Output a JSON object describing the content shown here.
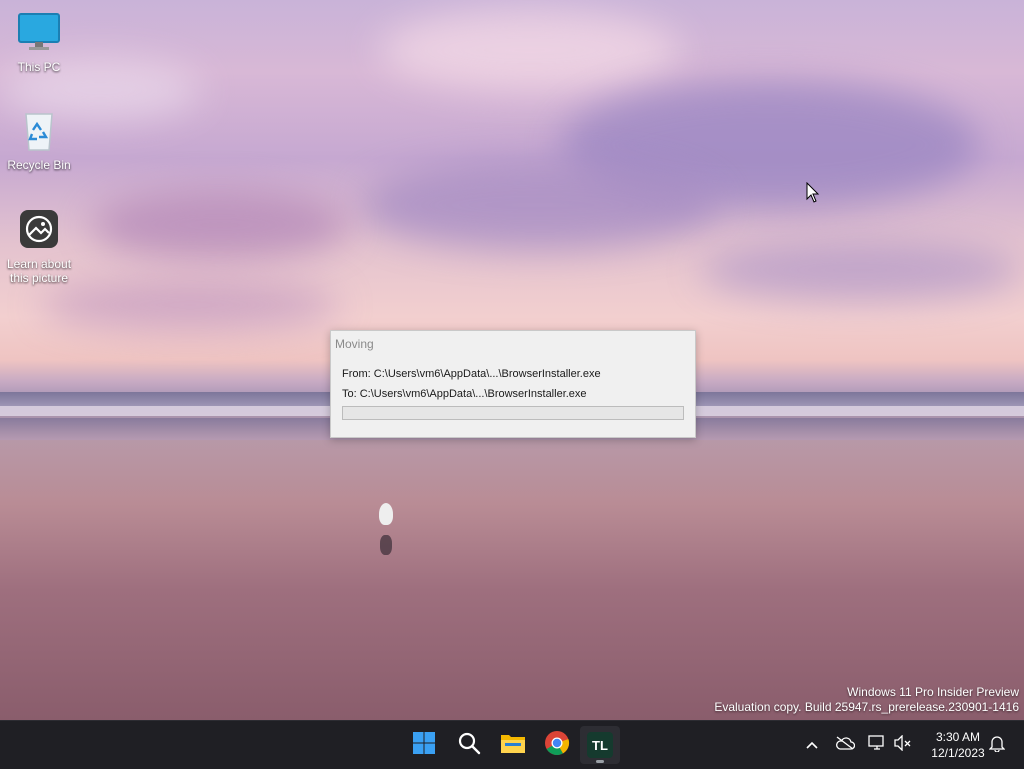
{
  "desktop_icons": [
    {
      "label": "This PC",
      "icon": "monitor-icon"
    },
    {
      "label": "Recycle Bin",
      "icon": "recycle-bin-icon"
    },
    {
      "label": "Learn about\nthis picture",
      "icon": "learn-picture-icon"
    }
  ],
  "dialog": {
    "title": "Moving",
    "from": "From: C:\\Users\\vm6\\AppData\\...\\BrowserInstaller.exe",
    "to": "To: C:\\Users\\vm6\\AppData\\...\\BrowserInstaller.exe",
    "progress_percent": 0
  },
  "watermark": {
    "line1": "Windows 11 Pro Insider Preview",
    "line2": "Evaluation copy. Build 25947.rs_prerelease.230901-1416"
  },
  "taskbar": {
    "apps": [
      {
        "name": "start",
        "icon": "windows-logo-icon"
      },
      {
        "name": "search",
        "icon": "search-icon"
      },
      {
        "name": "file-explorer",
        "icon": "folder-icon"
      },
      {
        "name": "chrome",
        "icon": "chrome-icon"
      },
      {
        "name": "tl-app",
        "icon": "tl-app-icon",
        "text": "TL"
      }
    ],
    "tray": {
      "chevron": "chevron-up-icon",
      "cloud": "onedrive-offline-icon",
      "network": "network-icon",
      "volume": "volume-muted-icon",
      "notifications": "bell-icon"
    },
    "time": "3:30 AM",
    "date": "12/1/2023"
  },
  "colors": {
    "taskbar_bg": "#1f1f24",
    "dialog_bg": "#f0f0f0",
    "windows_blue": "#0078d4"
  }
}
